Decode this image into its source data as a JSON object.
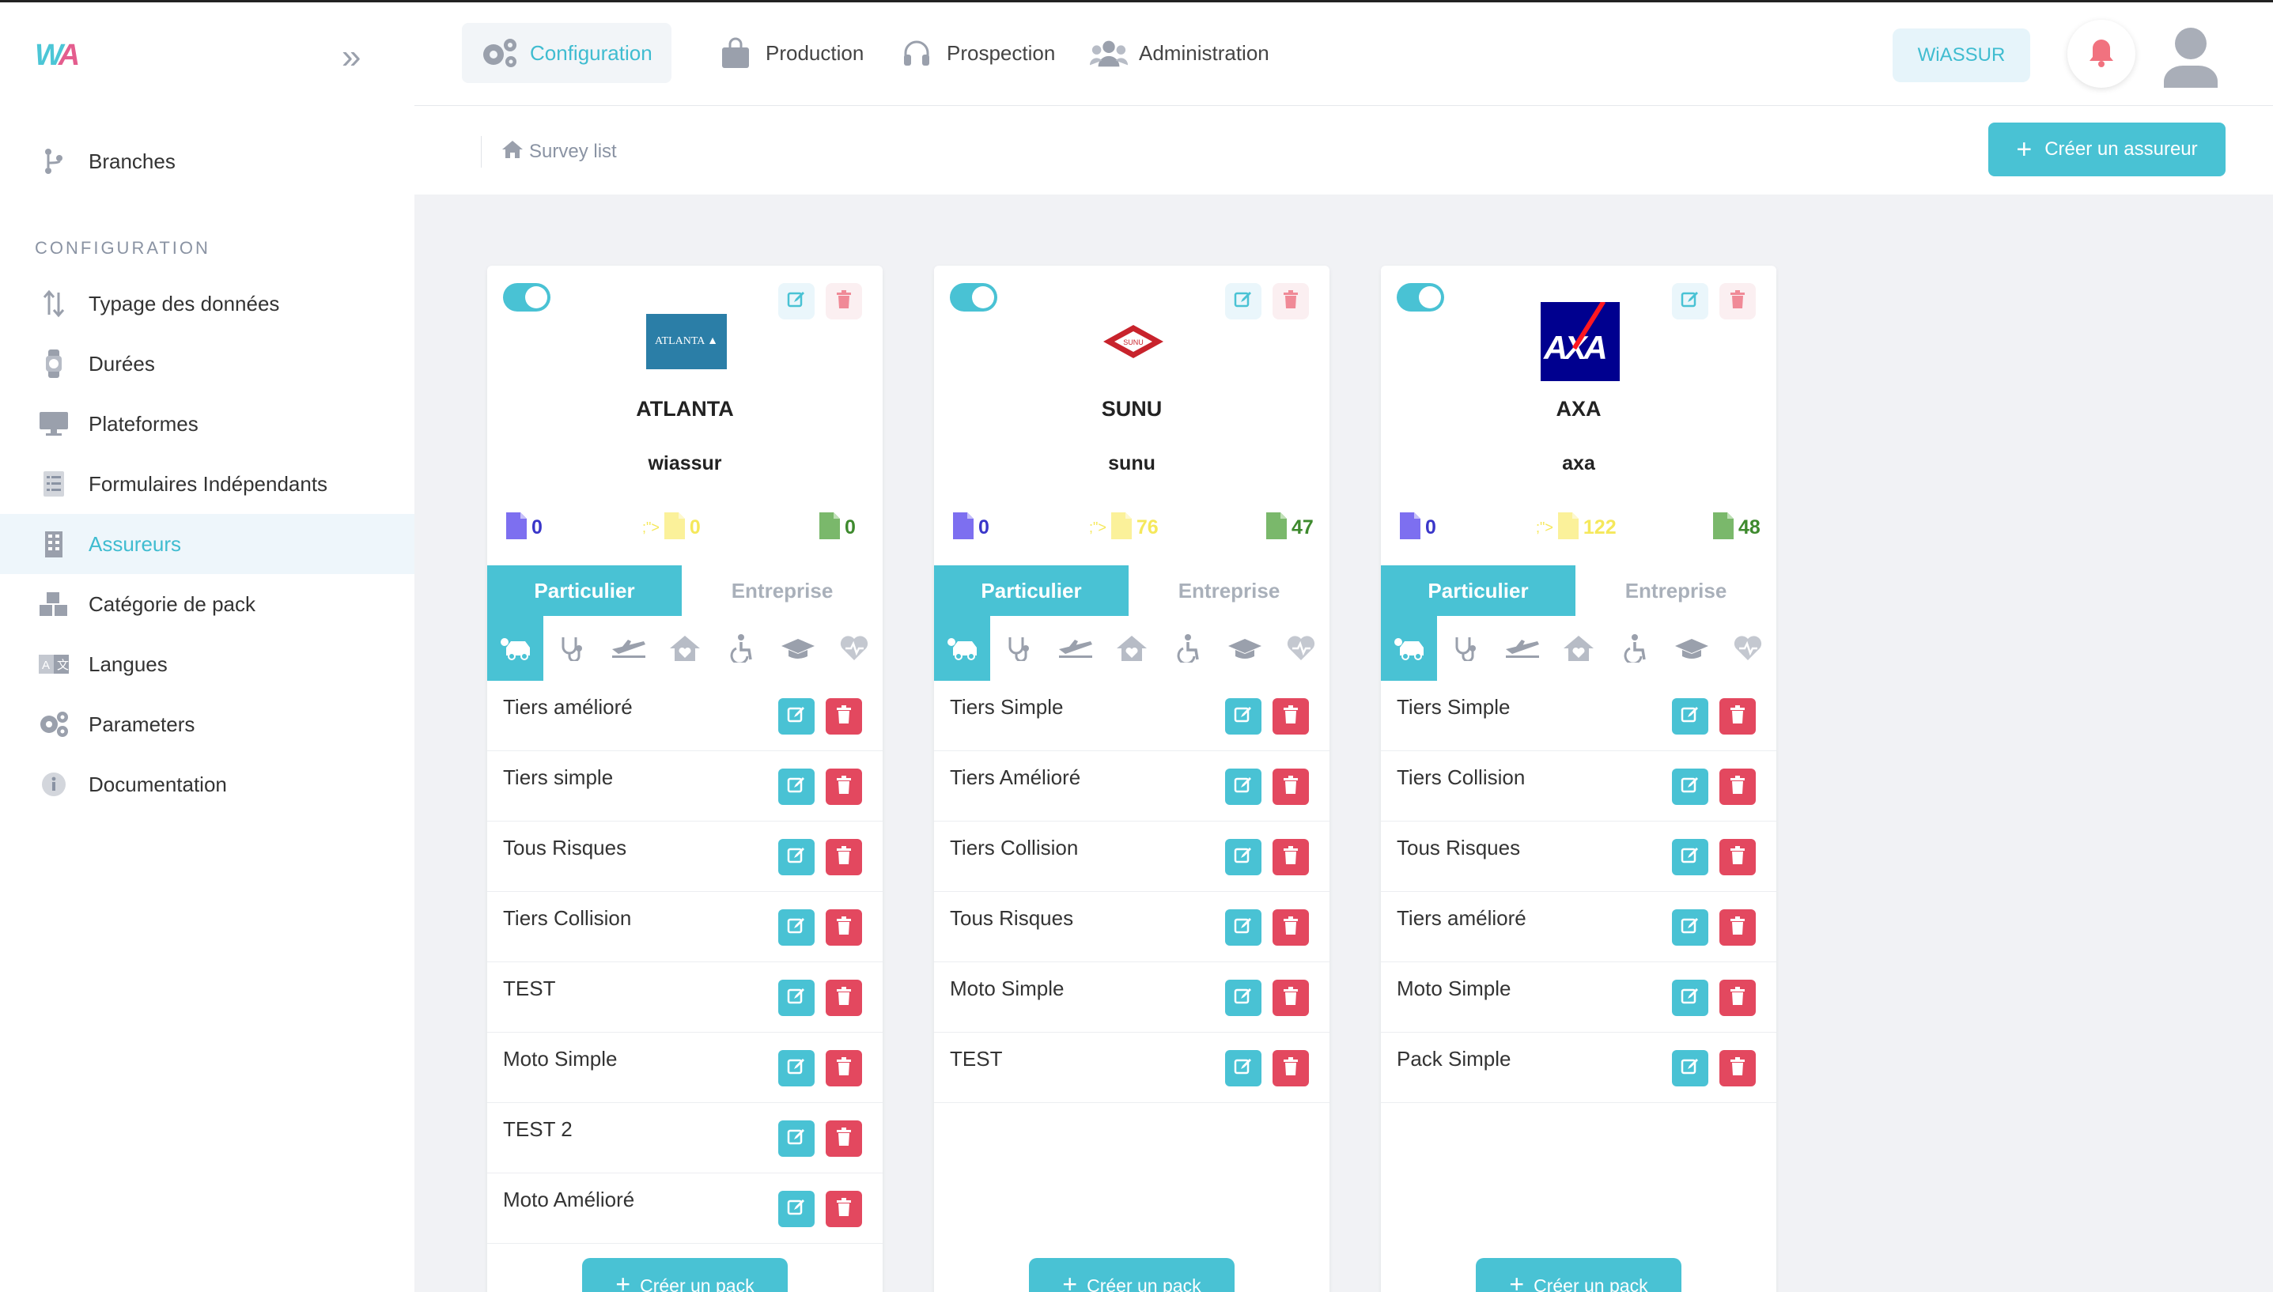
{
  "brand": {
    "logo_left": "W",
    "logo_right": "A"
  },
  "sidebar": {
    "top_item": "Branches",
    "section_label": "CONFIGURATION",
    "items": [
      {
        "label": "Typage des données",
        "icon": "sort-arrows-icon"
      },
      {
        "label": "Durées",
        "icon": "watch-icon"
      },
      {
        "label": "Plateformes",
        "icon": "monitor-icon"
      },
      {
        "label": "Formulaires Indépendants",
        "icon": "form-list-icon"
      },
      {
        "label": "Assureurs",
        "icon": "building-icon",
        "active": true
      },
      {
        "label": "Catégorie de pack",
        "icon": "boxes-icon"
      },
      {
        "label": "Langues",
        "icon": "translate-icon"
      },
      {
        "label": "Parameters",
        "icon": "gears-icon"
      },
      {
        "label": "Documentation",
        "icon": "info-icon"
      }
    ]
  },
  "topnav": {
    "tabs": [
      {
        "label": "Configuration",
        "icon": "gears-icon",
        "active": true
      },
      {
        "label": "Production",
        "icon": "shopping-bag-icon"
      },
      {
        "label": "Prospection",
        "icon": "headset-icon"
      },
      {
        "label": "Administration",
        "icon": "users-icon"
      }
    ],
    "org_button": "WiASSUR"
  },
  "breadcrumb": {
    "label": "Survey list"
  },
  "actions": {
    "create_insurer": "Créer un assureur"
  },
  "cards": [
    {
      "name": "ATLANTA",
      "code": "wiassur",
      "logo_text": "ATLANTA",
      "stats": {
        "blue": "0",
        "yellow_prefix": ";\">",
        "yellow": "0",
        "green": "0"
      },
      "segments": {
        "active": "Particulier",
        "inactive": "Entreprise"
      },
      "packs": [
        "Tiers amélioré",
        "Tiers simple",
        "Tous Risques",
        "Tiers Collision",
        "TEST",
        "Moto Simple",
        "TEST 2",
        "Moto Amélioré"
      ],
      "create_pack": "Créer un pack"
    },
    {
      "name": "SUNU",
      "code": "sunu",
      "logo_text": "SUNU",
      "stats": {
        "blue": "0",
        "yellow_prefix": ";\">",
        "yellow": "76",
        "green": "47"
      },
      "segments": {
        "active": "Particulier",
        "inactive": "Entreprise"
      },
      "packs": [
        "Tiers Simple",
        "Tiers Amélioré",
        "Tiers Collision",
        "Tous Risques",
        "Moto Simple",
        "TEST"
      ],
      "create_pack": "Créer un pack"
    },
    {
      "name": "AXA",
      "code": "axa",
      "logo_text": "AXA",
      "stats": {
        "blue": "0",
        "yellow_prefix": ";\">",
        "yellow": "122",
        "green": "48"
      },
      "segments": {
        "active": "Particulier",
        "inactive": "Entreprise"
      },
      "packs": [
        "Tiers Simple",
        "Tiers Collision",
        "Tous Risques",
        "Tiers amélioré",
        "Moto Simple",
        "Pack Simple"
      ],
      "create_pack": "Créer un pack"
    }
  ],
  "colors": {
    "accent": "#49c2d4",
    "danger": "#e3485f",
    "stat_blue": "#3a36c9",
    "stat_yellow": "#f5e85b",
    "stat_green": "#3e8a2e"
  }
}
